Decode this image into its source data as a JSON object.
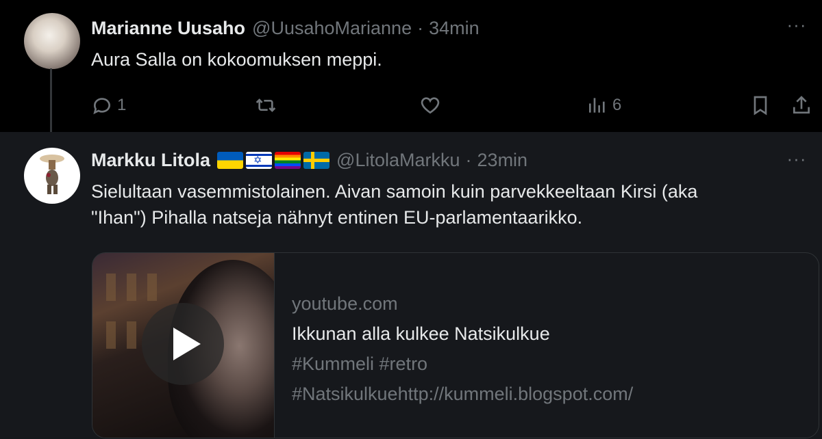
{
  "tweets": [
    {
      "display_name": "Marianne Uusaho",
      "handle": "@UusahoMarianne",
      "separator": "·",
      "time": "34min",
      "text": "Aura Salla on kokoomuksen meppi.",
      "actions": {
        "replies": "1",
        "retweets": "",
        "likes": "",
        "views": "6"
      }
    },
    {
      "display_name": "Markku Litola",
      "handle": "@LitolaMarkku",
      "separator": "·",
      "time": "23min",
      "flags": [
        "flag-ukraine-icon",
        "flag-israel-icon",
        "flag-rainbow-icon",
        "flag-sweden-icon"
      ],
      "text_line1": "Sielultaan vasemmistolainen. Aivan samoin kuin parvekkeeltaan Kirsi (aka",
      "text_line2": "\"Ihan\") Pihalla natseja nähnyt entinen EU-parlamentaarikko.",
      "card": {
        "domain": "youtube.com",
        "title": "Ikkunan alla kulkee Natsikulkue",
        "desc_line1": "#Kummeli #retro",
        "desc_line2": "#Natsikulkuehttp://kummeli.blogspot.com/"
      }
    }
  ],
  "more_label": "···"
}
